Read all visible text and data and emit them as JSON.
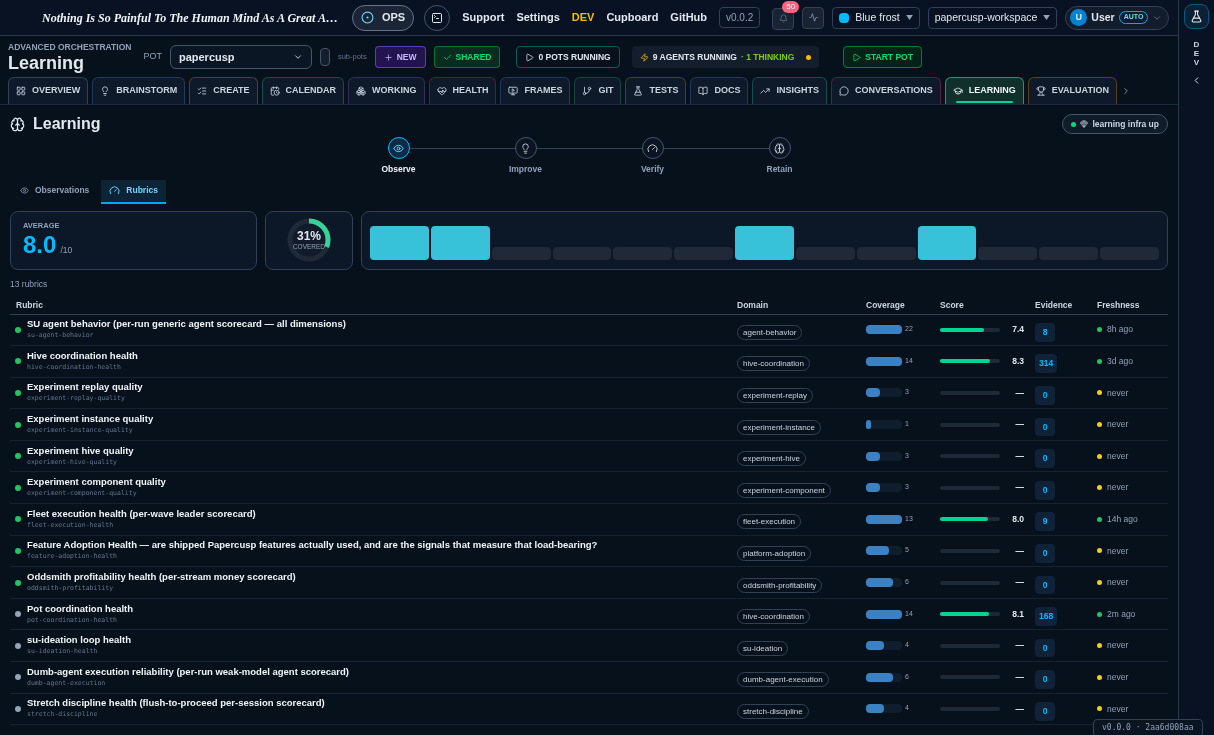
{
  "topbar": {
    "quote": "Nothing Is So Painful To The Human Mind As A Great A…",
    "ops": "OPS",
    "links": [
      {
        "label": "Support",
        "selected": false
      },
      {
        "label": "Settings",
        "selected": false
      },
      {
        "label": "DEV",
        "selected": true
      },
      {
        "label": "Cupboard",
        "selected": false
      },
      {
        "label": "GitHub",
        "selected": false
      }
    ],
    "version": "v0.0.2",
    "notifications": "50",
    "theme": "Blue frost",
    "workspace": "papercusp-workspace",
    "user": {
      "initial": "U",
      "name": "User",
      "badge": "AUTO"
    }
  },
  "header": {
    "eyebrow": "ADVANCED ORCHESTRATION",
    "title": "Learning",
    "pot_label": "POT",
    "pot": "papercusp",
    "subpots": {
      "label": "sub-pots",
      "checked": false
    },
    "new": "NEW",
    "shared": "SHARED",
    "pots_running": "0 POTS RUNNING",
    "agents_running": "9 AGENTS RUNNING",
    "thinking": "· 1 THINKING",
    "start": "START POT"
  },
  "tabs": [
    {
      "label": "OVERVIEW",
      "color": "#334155",
      "selected": false
    },
    {
      "label": "BRAINSTORM",
      "color": "#1e3a5f",
      "selected": false
    },
    {
      "label": "CREATE",
      "color": "#5c3d14",
      "selected": false
    },
    {
      "label": "CALENDAR",
      "color": "#134e4a",
      "selected": false
    },
    {
      "label": "WORKING",
      "color": "#312e5f",
      "selected": false
    },
    {
      "label": "HEALTH",
      "color": "#5f1d2b",
      "selected": false
    },
    {
      "label": "FRAMES",
      "color": "#1e3a5f",
      "selected": false
    },
    {
      "label": "GIT",
      "color": "#14463a",
      "selected": false
    },
    {
      "label": "TESTS",
      "color": "#3a4a14",
      "selected": false
    },
    {
      "label": "DOCS",
      "color": "#1e3a5f",
      "selected": false
    },
    {
      "label": "INSIGHTS",
      "color": "#134e4a",
      "selected": false
    },
    {
      "label": "CONVERSATIONS",
      "color": "#5b1d44",
      "selected": false
    },
    {
      "label": "LEARNING",
      "color": "#2f8f74",
      "selected": true
    },
    {
      "label": "EVALUATION",
      "color": "#5c3d14",
      "selected": false
    }
  ],
  "page": {
    "title": "Learning",
    "status": "learning infra up"
  },
  "steps": [
    {
      "label": "Observe",
      "selected": true
    },
    {
      "label": "Improve",
      "selected": false
    },
    {
      "label": "Verify",
      "selected": false
    },
    {
      "label": "Retain",
      "selected": false
    }
  ],
  "subtabs": [
    {
      "label": "Observations",
      "selected": false
    },
    {
      "label": "Rubrics",
      "selected": true
    }
  ],
  "summary": {
    "average_label": "AVERAGE",
    "average": "8.0",
    "average_max": "/10",
    "covered": {
      "reading": "31%",
      "label": "COVERED",
      "level": 0.31
    },
    "strip": [
      {
        "active": true
      },
      {
        "active": true
      },
      {
        "active": false
      },
      {
        "active": false
      },
      {
        "active": false
      },
      {
        "active": false
      },
      {
        "active": true
      },
      {
        "active": false
      },
      {
        "active": false
      },
      {
        "active": true
      },
      {
        "active": false
      },
      {
        "active": false
      },
      {
        "active": false
      }
    ]
  },
  "count": "13 rubrics",
  "table": {
    "columns": [
      "Rubric",
      "Domain",
      "Coverage",
      "Score",
      "Evidence",
      "Freshness"
    ],
    "rows": [
      {
        "title": "SU agent behavior (per-run generic agent scorecard — all dimensions)",
        "slug": "su-agent-behavior",
        "color": "#22c55e",
        "domain": "agent-behavior",
        "coverage": {
          "count": "22",
          "level": 1
        },
        "score": {
          "level": 0.74,
          "reading": "7.4"
        },
        "evidence": "8",
        "freshness": {
          "text": "8h ago",
          "color": "#22c55e"
        }
      },
      {
        "title": "Hive coordination health",
        "slug": "hive-coordination-health",
        "color": "#22c55e",
        "domain": "hive-coordination",
        "coverage": {
          "count": "14",
          "level": 1
        },
        "score": {
          "level": 0.83,
          "reading": "8.3"
        },
        "evidence": "314",
        "freshness": {
          "text": "3d ago",
          "color": "#22c55e"
        }
      },
      {
        "title": "Experiment replay quality",
        "slug": "experiment-replay-quality",
        "color": "#22c55e",
        "domain": "experiment-replay",
        "coverage": {
          "count": "3",
          "level": 0.375
        },
        "score": {
          "level": 0,
          "reading": "—"
        },
        "evidence": "0",
        "freshness": {
          "text": "never",
          "color": "#facc15"
        }
      },
      {
        "title": "Experiment instance quality",
        "slug": "experiment-instance-quality",
        "color": "#22c55e",
        "domain": "experiment-instance",
        "coverage": {
          "count": "1",
          "level": 0.125
        },
        "score": {
          "level": 0,
          "reading": "—"
        },
        "evidence": "0",
        "freshness": {
          "text": "never",
          "color": "#facc15"
        }
      },
      {
        "title": "Experiment hive quality",
        "slug": "experiment-hive-quality",
        "color": "#22c55e",
        "domain": "experiment-hive",
        "coverage": {
          "count": "3",
          "level": 0.375
        },
        "score": {
          "level": 0,
          "reading": "—"
        },
        "evidence": "0",
        "freshness": {
          "text": "never",
          "color": "#facc15"
        }
      },
      {
        "title": "Experiment component quality",
        "slug": "experiment-component-quality",
        "color": "#22c55e",
        "domain": "experiment-component",
        "coverage": {
          "count": "3",
          "level": 0.375
        },
        "score": {
          "level": 0,
          "reading": "—"
        },
        "evidence": "0",
        "freshness": {
          "text": "never",
          "color": "#facc15"
        }
      },
      {
        "title": "Fleet execution health (per-wave leader scorecard)",
        "slug": "fleet-execution-health",
        "color": "#22c55e",
        "domain": "fleet-execution",
        "coverage": {
          "count": "13",
          "level": 1
        },
        "score": {
          "level": 0.8,
          "reading": "8.0"
        },
        "evidence": "9",
        "freshness": {
          "text": "14h ago",
          "color": "#22c55e"
        }
      },
      {
        "title": "Feature Adoption Health — are shipped Papercusp features actually used, and are the signals that measure that load-bearing?",
        "slug": "feature-adoption-health",
        "color": "#22c55e",
        "domain": "platform-adoption",
        "coverage": {
          "count": "5",
          "level": 0.625
        },
        "score": {
          "level": 0,
          "reading": "—"
        },
        "evidence": "0",
        "freshness": {
          "text": "never",
          "color": "#facc15"
        }
      },
      {
        "title": "Oddsmith profitability health (per-stream money scorecard)",
        "slug": "oddsmith-profitability",
        "color": "#22c55e",
        "domain": "oddsmith-profitability",
        "coverage": {
          "count": "6",
          "level": 0.75
        },
        "score": {
          "level": 0,
          "reading": "—"
        },
        "evidence": "0",
        "freshness": {
          "text": "never",
          "color": "#facc15"
        }
      },
      {
        "title": "Pot coordination health",
        "slug": "pot-coordination-health",
        "color": "#94a3b8",
        "domain": "hive-coordination",
        "coverage": {
          "count": "14",
          "level": 1
        },
        "score": {
          "level": 0.81,
          "reading": "8.1"
        },
        "evidence": "168",
        "freshness": {
          "text": "2m ago",
          "color": "#22c55e"
        }
      },
      {
        "title": "su-ideation loop health",
        "slug": "su-ideation-health",
        "color": "#94a3b8",
        "domain": "su-ideation",
        "coverage": {
          "count": "4",
          "level": 0.5
        },
        "score": {
          "level": 0,
          "reading": "—"
        },
        "evidence": "0",
        "freshness": {
          "text": "never",
          "color": "#facc15"
        }
      },
      {
        "title": "Dumb-agent execution reliability (per-run weak-model agent scorecard)",
        "slug": "dumb-agent-execution",
        "color": "#94a3b8",
        "domain": "dumb-agent-execution",
        "coverage": {
          "count": "6",
          "level": 0.75
        },
        "score": {
          "level": 0,
          "reading": "—"
        },
        "evidence": "0",
        "freshness": {
          "text": "never",
          "color": "#facc15"
        }
      },
      {
        "title": "Stretch discipline health (flush-to-proceed per-session scorecard)",
        "slug": "stretch-discipline",
        "color": "#94a3b8",
        "domain": "stretch-discipline",
        "coverage": {
          "count": "4",
          "level": 0.5
        },
        "score": {
          "level": 0,
          "reading": "—"
        },
        "evidence": "0",
        "freshness": {
          "text": "never",
          "color": "#facc15"
        }
      }
    ]
  },
  "rail": {
    "label": "DEV"
  },
  "build": "v0.0.0 · 2aa6d008aa"
}
